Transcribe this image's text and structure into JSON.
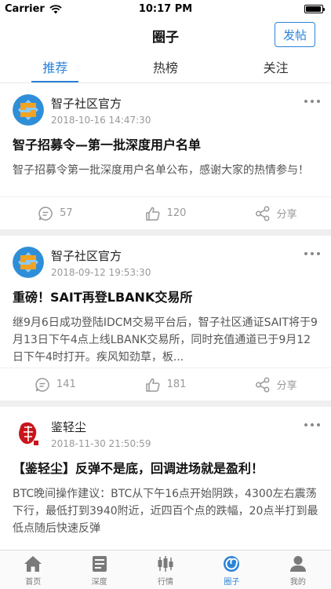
{
  "status": {
    "carrier": "Carrier",
    "time": "10:17 PM",
    "battery_level": 0.95
  },
  "nav": {
    "title": "圈子",
    "post_button": "发帖"
  },
  "tabs": [
    {
      "label": "推荐"
    },
    {
      "label": "热榜"
    },
    {
      "label": "关注"
    }
  ],
  "posts": [
    {
      "author": "智子社区官方",
      "time": "2018-10-16 14:47:30",
      "title": "智子招募令—第一批深度用户名单",
      "body": "智子招募令第一批深度用户名单公布，感谢大家的热情参与！",
      "comments": "57",
      "likes": "120",
      "share": "分享",
      "avatar": "zhizi-logo"
    },
    {
      "author": "智子社区官方",
      "time": "2018-09-12 19:53:30",
      "title": "重磅！SAIT再登LBANK交易所",
      "body": "  继9月6日成功登陆IDCM交易平台后，智子社区通证SAIT将于9月13日下午4点上线LBANK交易所，同时充值通道已于9月12日下午4时打开。疾风知劲草，板...",
      "comments": "141",
      "likes": "181",
      "share": "分享",
      "avatar": "zhizi-logo"
    },
    {
      "author": "鉴轻尘",
      "time": "2018-11-30 21:50:59",
      "title": "【鉴轻尘】反弹不是底，回调进场就是盈利！",
      "body": "BTC晚间操作建议：BTC从下午16点开始阴跌，4300左右震荡下行，最低打到3940附近，近四百个点的跌幅，20点半打到最低点随后快速反弹",
      "avatar": "red-seal"
    }
  ],
  "tabbar": [
    {
      "label": "首页",
      "icon": "home-icon"
    },
    {
      "label": "深度",
      "icon": "article-icon"
    },
    {
      "label": "行情",
      "icon": "candlestick-icon"
    },
    {
      "label": "圈子",
      "icon": "circle-icon"
    },
    {
      "label": "我的",
      "icon": "person-icon"
    }
  ],
  "colors": {
    "accent": "#2b83d8",
    "gap": "#efefef",
    "muted": "#999999"
  }
}
